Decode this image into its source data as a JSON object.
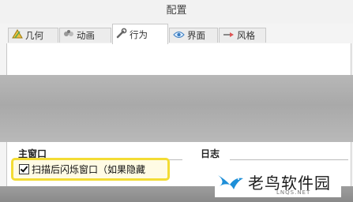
{
  "window": {
    "title": "配置"
  },
  "tabs": [
    {
      "label": "几何",
      "icon": "geometry-icon"
    },
    {
      "label": "动画",
      "icon": "animation-icon"
    },
    {
      "label": "行为",
      "icon": "wrench-icon",
      "active": true
    },
    {
      "label": "界面",
      "icon": "eye-icon"
    },
    {
      "label": "风格",
      "icon": "style-icon"
    }
  ],
  "groups": {
    "left_title": "主窗口",
    "right_title": "日志"
  },
  "options": {
    "flash_on_scan_label": "扫描后闪烁窗口（如果隐藏"
  },
  "watermark": {
    "name": "老鸟软件园",
    "url": "LNQS.NET"
  },
  "colors": {
    "highlight": "#f3dc34",
    "brand_blue": "#1e8fd8"
  }
}
